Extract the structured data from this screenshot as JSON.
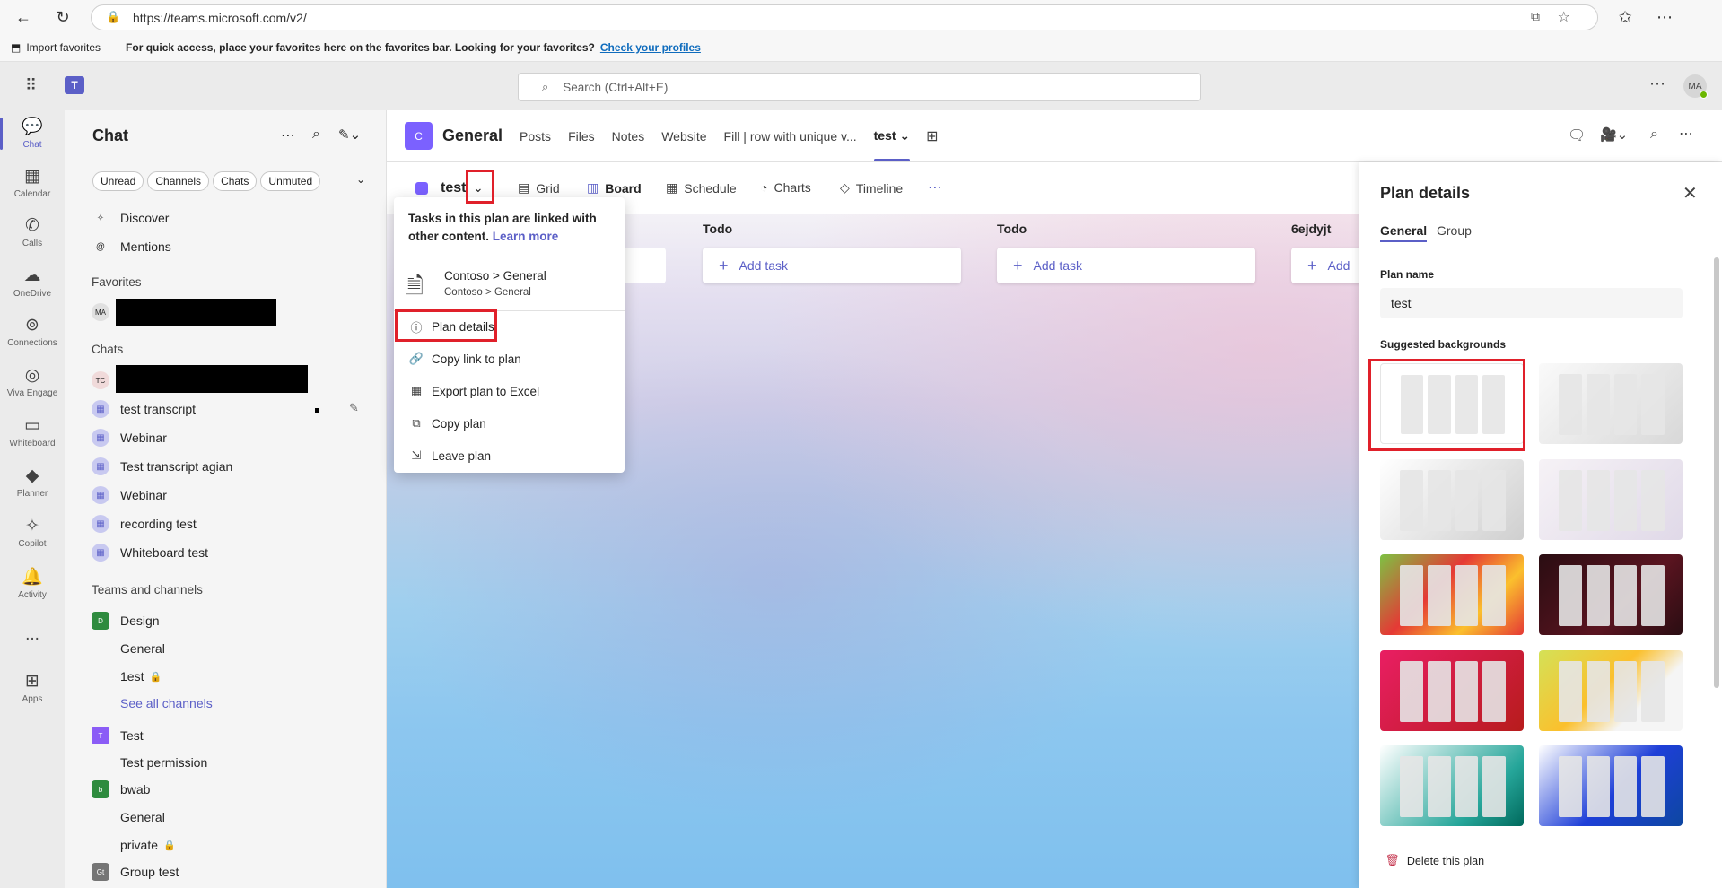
{
  "browser": {
    "url": "https://teams.microsoft.com/v2/",
    "import_favorites": "Import favorites",
    "fav_message": "For quick access, place your favorites here on the favorites bar. Looking for your favorites?",
    "fav_link": "Check your profiles"
  },
  "topbar": {
    "search_placeholder": "Search (Ctrl+Alt+E)",
    "avatar": "MA"
  },
  "rail": [
    {
      "label": "Chat",
      "icon": "chat-icon"
    },
    {
      "label": "Calendar",
      "icon": "calendar-icon"
    },
    {
      "label": "Calls",
      "icon": "phone-icon"
    },
    {
      "label": "OneDrive",
      "icon": "cloud-icon"
    },
    {
      "label": "Connections",
      "icon": "connections-icon"
    },
    {
      "label": "Viva Engage",
      "icon": "viva-icon"
    },
    {
      "label": "Whiteboard",
      "icon": "whiteboard-icon"
    },
    {
      "label": "Planner",
      "icon": "planner-icon"
    },
    {
      "label": "Copilot",
      "icon": "copilot-icon"
    },
    {
      "label": "Activity",
      "icon": "bell-icon"
    },
    {
      "label": "...",
      "icon": "more-icon"
    },
    {
      "label": "Apps",
      "icon": "apps-icon"
    }
  ],
  "chatpane": {
    "title": "Chat",
    "filters": [
      "Unread",
      "Channels",
      "Chats",
      "Unmuted"
    ],
    "discover": "Discover",
    "mentions": "Mentions",
    "favorites_header": "Favorites",
    "fav_avatar": "MA",
    "chats_header": "Chats",
    "chat_avatar": "TC",
    "chats": [
      "test transcript",
      "Webinar",
      "Test transcript agian",
      "Webinar",
      "recording test",
      "Whiteboard test"
    ],
    "teams_header": "Teams and channels",
    "teams": {
      "design": "Design",
      "design_initial": "D",
      "design_general": "General",
      "design_1est": "1est",
      "see_all": "See all channels",
      "test": "Test",
      "test_initial": "T",
      "test_permission": "Test permission",
      "bwab": "bwab",
      "bwab_initial": "b",
      "bwab_general": "General",
      "bwab_private": "private",
      "group_test": "Group test",
      "group_initial": "Gt"
    }
  },
  "channel": {
    "initial": "C",
    "name": "General",
    "tabs": [
      "Posts",
      "Files",
      "Notes",
      "Website",
      "Fill | row with unique v...",
      "test"
    ]
  },
  "plan": {
    "name": "test",
    "views": [
      "Grid",
      "Board",
      "Schedule",
      "Charts",
      "Timeline"
    ],
    "buckets": [
      "Todo",
      "Todo",
      "6ejdyjt"
    ],
    "add_task": "Add task",
    "add_task_truncated": "Add"
  },
  "menu": {
    "info_text": "Tasks in this plan are linked with other content.",
    "learn_more": "Learn more",
    "linked_title": "Contoso > General",
    "linked_sub": "Contoso > General",
    "items": [
      "Plan details",
      "Copy link to plan",
      "Export plan to Excel",
      "Copy plan",
      "Leave plan"
    ]
  },
  "details": {
    "title": "Plan details",
    "tabs": [
      "General",
      "Group"
    ],
    "plan_name_label": "Plan name",
    "plan_name_value": "test",
    "backgrounds_label": "Suggested backgrounds",
    "delete": "Delete this plan"
  },
  "colors": {
    "accent": "#5b5fc7",
    "highlight": "#e0202a"
  }
}
